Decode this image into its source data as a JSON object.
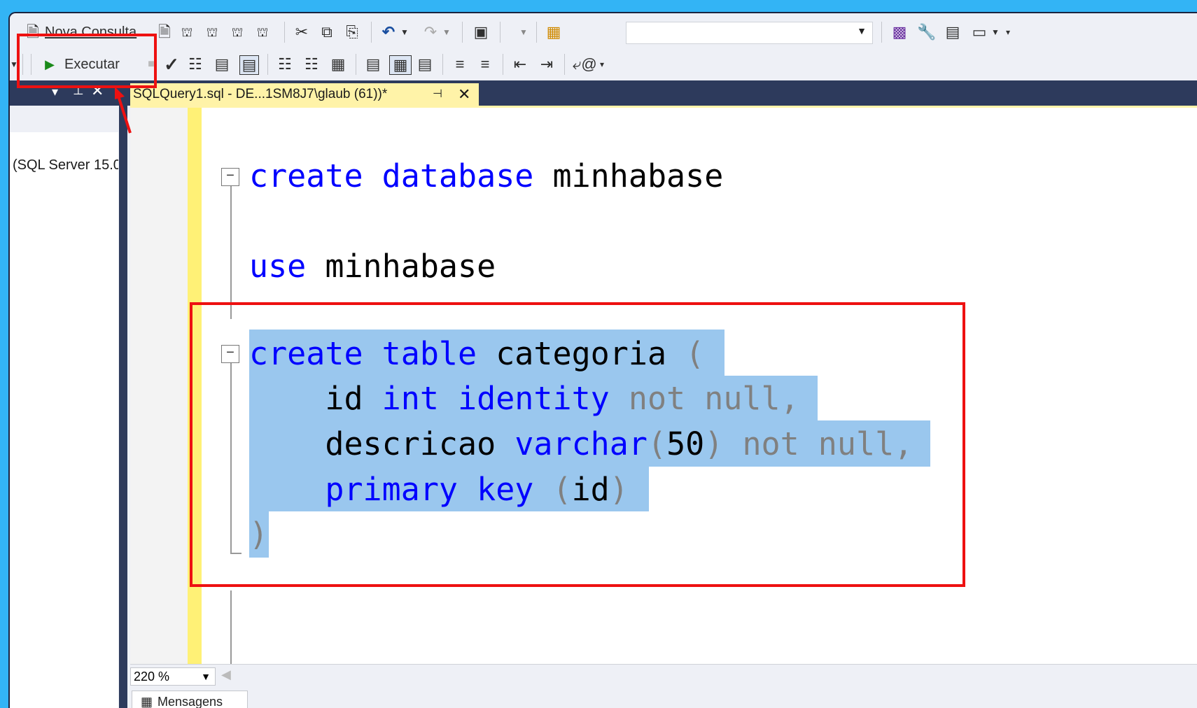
{
  "toolbar1": {
    "new_query_label": "Nova Consulta",
    "icons": [
      "mdx-query-icon",
      "dmx-query-icon",
      "xmla-query-icon",
      "dax-query-icon"
    ]
  },
  "toolbar2": {
    "execute_label": "Executar"
  },
  "tab": {
    "title": "SQLQuery1.sql - DE...1SM8J7\\glaub (61))*"
  },
  "left_panel": {
    "server_text": "(SQL Server 15.0"
  },
  "editor": {
    "lines": {
      "l1": {
        "kw1": "create",
        "kw2": "database",
        "name": "minhabase"
      },
      "l2": {
        "kw": "use",
        "name": "minhabase"
      },
      "l3": {
        "kw1": "create",
        "kw2": "table",
        "name": "categoria",
        "paren": "("
      },
      "l4": {
        "ident": "id",
        "type": "int",
        "ident_kw": "identity",
        "notnull": "not null,"
      },
      "l5": {
        "ident": "descricao",
        "type": "varchar",
        "open": "(",
        "num": "50",
        "close": ")",
        "notnull": "not null,"
      },
      "l6": {
        "kw": "primary key",
        "open": "(",
        "ident": "id",
        "close": ")"
      },
      "l7": {
        "paren": ")"
      }
    }
  },
  "status": {
    "zoom": "220 %",
    "messages_tab": "Mensagens"
  },
  "colors": {
    "keyword": "#0000ff",
    "gray": "#808080",
    "selection": "#9ac7ee",
    "annotation_red": "#ee1111"
  }
}
